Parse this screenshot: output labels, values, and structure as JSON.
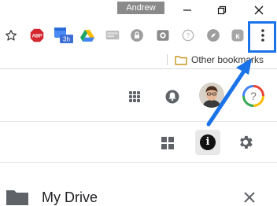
{
  "window": {
    "profile_name": "Andrew",
    "controls": [
      "minimize-icon",
      "restore-icon",
      "close-icon"
    ]
  },
  "toolbar": {
    "extensions": [
      {
        "name": "bookmark-star-icon"
      },
      {
        "name": "adblock-plus-icon",
        "label": "ABP"
      },
      {
        "name": "calendar-extension-icon",
        "badge": "3h"
      },
      {
        "name": "google-drive-icon"
      },
      {
        "name": "extension-icon"
      },
      {
        "name": "lock-extension-icon"
      },
      {
        "name": "camera-extension-icon"
      },
      {
        "name": "question-extension-icon"
      },
      {
        "name": "compass-extension-icon"
      },
      {
        "name": "puzzle-extension-icon"
      },
      {
        "name": "chrome-menu-icon"
      }
    ]
  },
  "bookmarks": {
    "other_bookmarks_label": "Other bookmarks"
  },
  "drive_header": {
    "help_symbol": "?"
  },
  "drive_toolbar": {
    "info_symbol": "i"
  },
  "details_panel": {
    "title": "My Drive"
  },
  "colors": {
    "highlight": "#1a73e8",
    "abp_red": "#d3262e",
    "info_active_bg": "#e8e8e8"
  }
}
